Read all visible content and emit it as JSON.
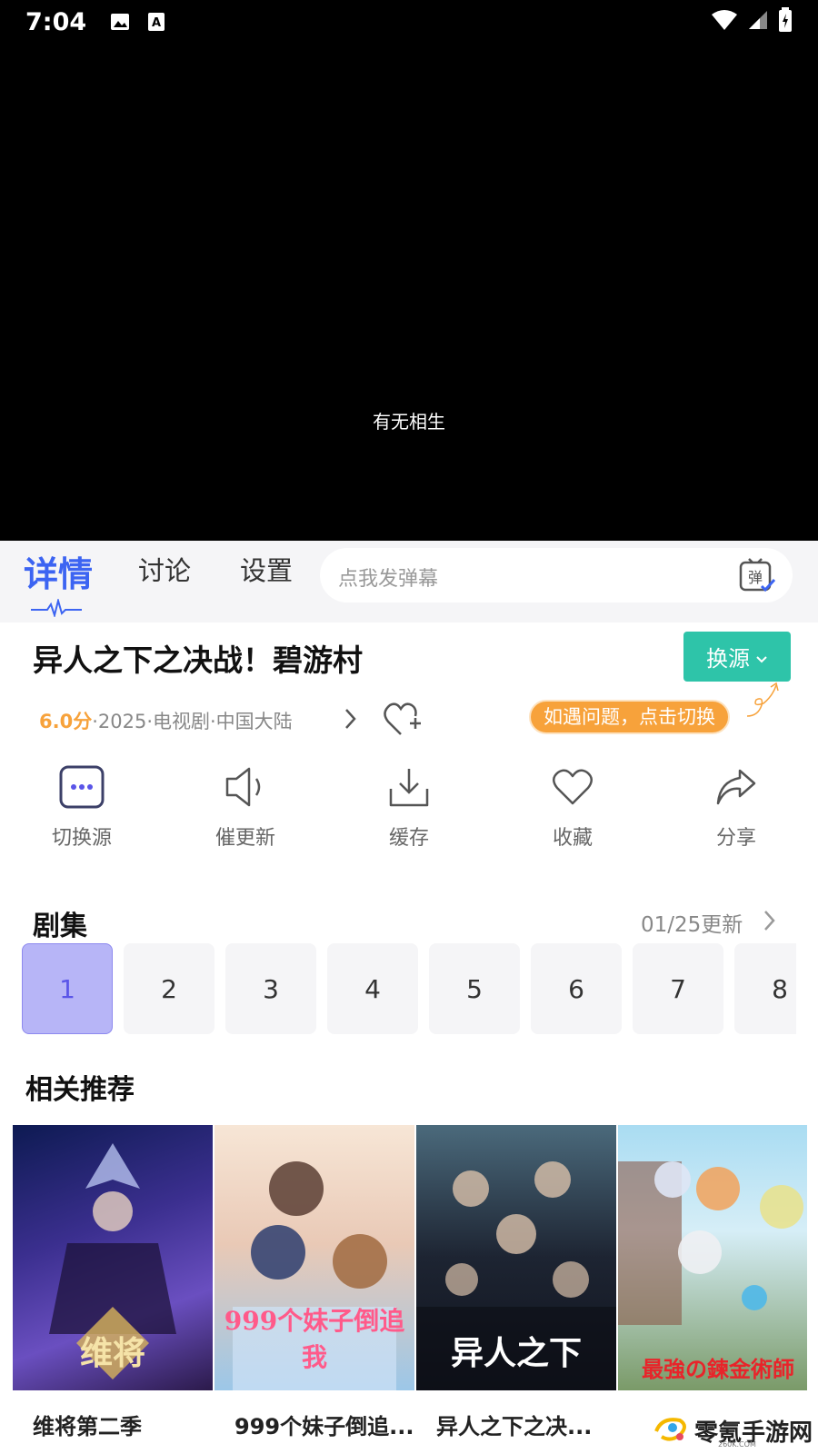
{
  "status_bar": {
    "time": "7:04"
  },
  "video": {
    "subtitle": "有无相生"
  },
  "tabs": [
    {
      "label": "详情",
      "active": true
    },
    {
      "label": "讨论",
      "active": false
    },
    {
      "label": "设置",
      "active": false
    }
  ],
  "danmaku": {
    "placeholder": "点我发弹幕",
    "icon_char": "弹"
  },
  "show": {
    "title": "异人之下之决战！碧游村",
    "score": "6.0分",
    "meta": "·2025·电视剧·中国大陆",
    "switch_source_label": "换源",
    "tip": "如遇问题，点击切换"
  },
  "actions": [
    {
      "label": "切换源",
      "icon": "switch-source-icon"
    },
    {
      "label": "催更新",
      "icon": "speaker-icon"
    },
    {
      "label": "缓存",
      "icon": "download-icon"
    },
    {
      "label": "收藏",
      "icon": "heart-icon"
    },
    {
      "label": "分享",
      "icon": "share-icon"
    }
  ],
  "episodes": {
    "title": "剧集",
    "update": "01/25更新",
    "items": [
      "1",
      "2",
      "3",
      "4",
      "5",
      "6",
      "7",
      "8"
    ],
    "active": "1"
  },
  "recommendations": {
    "title": "相关推荐",
    "items": [
      {
        "name": "维将第二季",
        "poster_text": "维将",
        "colors": [
          "#1b2a6b",
          "#6a4fc0"
        ]
      },
      {
        "name": "999个妹子倒追...",
        "poster_text": "999个妹子倒追我",
        "colors": [
          "#f3d9c6",
          "#9cc7e8"
        ]
      },
      {
        "name": "异人之下之决...",
        "poster_text": "异人之下",
        "colors": [
          "#1a1e2c",
          "#3b5266"
        ]
      },
      {
        "name": "",
        "poster_text": "最強の鍊金術師",
        "colors": [
          "#9fd6f0",
          "#6c8c5a"
        ]
      }
    ]
  },
  "watermark": {
    "text": "零氪手游网",
    "sub": "260K.COM"
  },
  "colors": {
    "accent": "#3c64f2",
    "teal": "#2ec4a9",
    "orange": "#f7a23b",
    "episode_active": "#b7b5f7"
  }
}
